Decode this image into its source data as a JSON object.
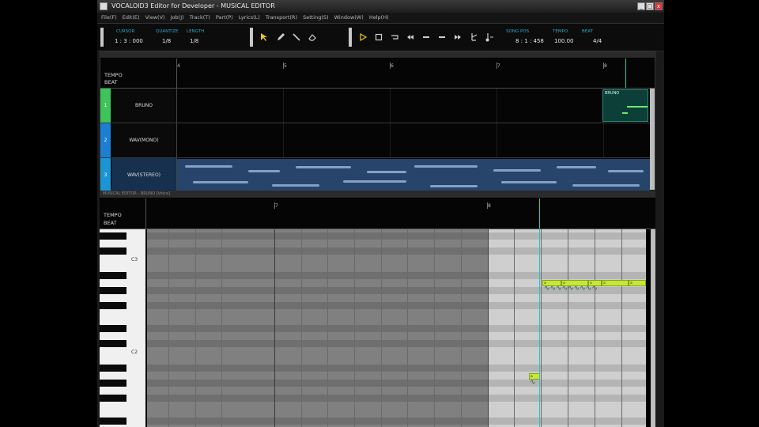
{
  "window": {
    "title": "VOCALOID3 Editor for Developer - MUSICAL EDITOR",
    "minimize": "_",
    "maximize": "□",
    "close": "x"
  },
  "menu": [
    "File(F)",
    "Edit(E)",
    "View(V)",
    "Job(J)",
    "Track(T)",
    "Part(P)",
    "Lyrics(L)",
    "Transport(R)",
    "Setting(S)",
    "Window(W)",
    "Help(H)"
  ],
  "toolbar": {
    "cursor_label": "CURSOR",
    "cursor_value": "1 : 3 : 000",
    "quantize_label": "QUANTIZE",
    "quantize_value": "1/8",
    "length_label": "LENGTH",
    "length_value": "1/8",
    "songpos_label": "SONG POS",
    "songpos_value": "8 : 1 : 458",
    "tempo_label": "TEMPO",
    "tempo_value": "100.00",
    "beat_label": "BEAT",
    "beat_value": "4/4",
    "accent": "#2aa8c8"
  },
  "arrange": {
    "tempo_label": "TEMPO",
    "beat_label": "BEAT",
    "bars": [
      "4",
      "5",
      "6",
      "7",
      "8"
    ],
    "tracks": [
      {
        "num": "1",
        "name": "BRUNO",
        "color": "#3ec45a"
      },
      {
        "num": "2",
        "name": "WAV(MONO)",
        "color": "#1b7fd4"
      },
      {
        "num": "3",
        "name": "WAV(STEREO)",
        "color": "#1b95d4"
      }
    ],
    "part_label": "BRUNO"
  },
  "musical": {
    "header": "MUSICAL EDITOR - BRUNO [Voice]",
    "tempo_label": "TEMPO",
    "beat_label": "BEAT",
    "bars": [
      "7",
      "8"
    ],
    "key_labels": [
      "C3",
      "C2"
    ],
    "notes": [
      {
        "lyric": "a",
        "pitch": "C#3"
      },
      {
        "lyric": "a",
        "pitch": "C#3"
      },
      {
        "lyric": "a",
        "pitch": "C#3"
      },
      {
        "lyric": "a",
        "pitch": "C#3"
      },
      {
        "lyric": "a",
        "pitch": "C#3"
      },
      {
        "lyric": "a",
        "pitch": "E2"
      }
    ],
    "note_color": "#c8e63a",
    "playhead_color": "#28c8b8"
  }
}
